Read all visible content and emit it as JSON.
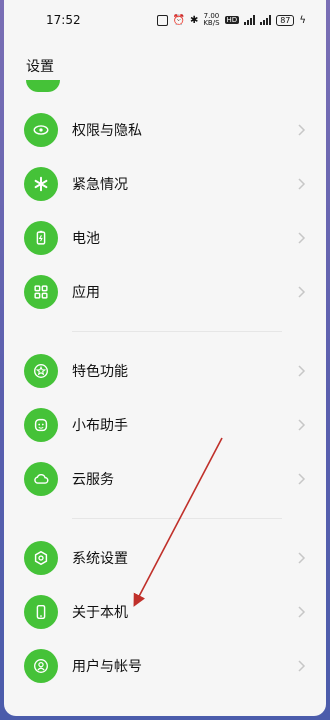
{
  "status_bar": {
    "time": "17:52",
    "net_speed_top": "7.00",
    "net_speed_unit": "KB/S",
    "hd_badge": "HD",
    "battery_level": "87"
  },
  "header": {
    "title": "设置"
  },
  "menu": {
    "items": [
      {
        "label": "权限与隐私",
        "icon": "privacy-eye-icon"
      },
      {
        "label": "紧急情况",
        "icon": "emergency-asterisk-icon"
      },
      {
        "label": "电池",
        "icon": "battery-icon"
      },
      {
        "label": "应用",
        "icon": "apps-grid-icon"
      },
      {
        "label": "特色功能",
        "icon": "star-icon"
      },
      {
        "label": "小布助手",
        "icon": "assistant-icon"
      },
      {
        "label": "云服务",
        "icon": "cloud-icon"
      },
      {
        "label": "系统设置",
        "icon": "hexagon-settings-icon"
      },
      {
        "label": "关于本机",
        "icon": "phone-icon"
      },
      {
        "label": "用户与帐号",
        "icon": "user-icon"
      }
    ]
  },
  "colors": {
    "accent_green": "#45c238",
    "annotation_red": "#c0302a"
  }
}
